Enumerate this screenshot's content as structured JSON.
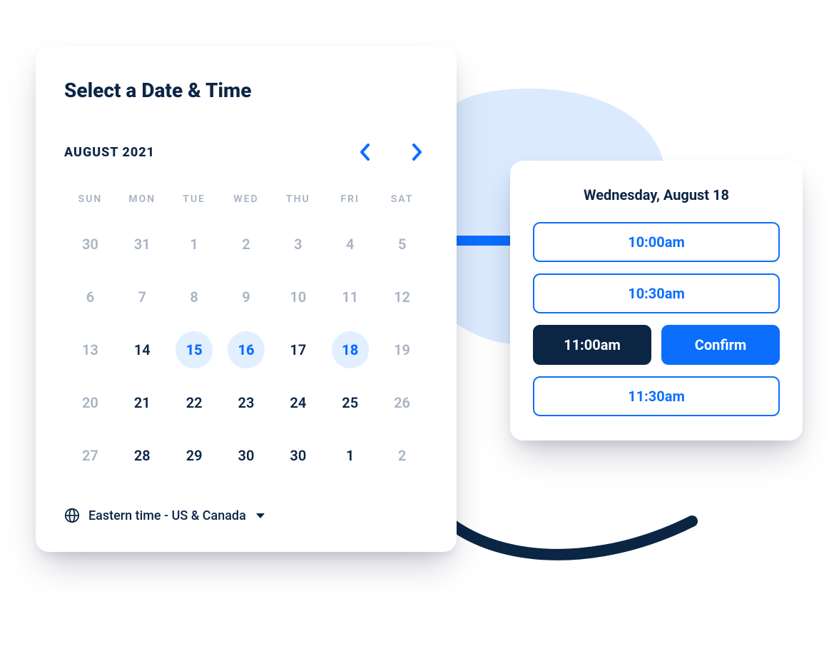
{
  "calendar": {
    "title": "Select a Date & Time",
    "month_label": "AUGUST 2021",
    "dow": [
      "SUN",
      "MON",
      "TUE",
      "WED",
      "THU",
      "FRI",
      "SAT"
    ],
    "weeks": [
      [
        {
          "n": "30",
          "state": "muted"
        },
        {
          "n": "31",
          "state": "muted"
        },
        {
          "n": "1",
          "state": "muted"
        },
        {
          "n": "2",
          "state": "muted"
        },
        {
          "n": "3",
          "state": "muted"
        },
        {
          "n": "4",
          "state": "muted"
        },
        {
          "n": "5",
          "state": "muted"
        }
      ],
      [
        {
          "n": "6",
          "state": "muted"
        },
        {
          "n": "7",
          "state": "muted"
        },
        {
          "n": "8",
          "state": "muted"
        },
        {
          "n": "9",
          "state": "muted"
        },
        {
          "n": "10",
          "state": "muted"
        },
        {
          "n": "11",
          "state": "muted"
        },
        {
          "n": "12",
          "state": "muted"
        }
      ],
      [
        {
          "n": "13",
          "state": "muted"
        },
        {
          "n": "14",
          "state": "in-month"
        },
        {
          "n": "15",
          "state": "available"
        },
        {
          "n": "16",
          "state": "available"
        },
        {
          "n": "17",
          "state": "in-month"
        },
        {
          "n": "18",
          "state": "available"
        },
        {
          "n": "19",
          "state": "muted"
        }
      ],
      [
        {
          "n": "20",
          "state": "muted"
        },
        {
          "n": "21",
          "state": "in-month"
        },
        {
          "n": "22",
          "state": "in-month"
        },
        {
          "n": "23",
          "state": "in-month"
        },
        {
          "n": "24",
          "state": "in-month"
        },
        {
          "n": "25",
          "state": "in-month"
        },
        {
          "n": "26",
          "state": "muted"
        }
      ],
      [
        {
          "n": "27",
          "state": "muted"
        },
        {
          "n": "28",
          "state": "in-month"
        },
        {
          "n": "29",
          "state": "in-month"
        },
        {
          "n": "30",
          "state": "in-month"
        },
        {
          "n": "30",
          "state": "in-month"
        },
        {
          "n": "1",
          "state": "in-month"
        },
        {
          "n": "2",
          "state": "muted"
        }
      ]
    ],
    "timezone": "Eastern time - US & Canada"
  },
  "timepanel": {
    "date_label": "Wednesday, August 18",
    "slots": [
      {
        "label": "10:00am",
        "state": "open"
      },
      {
        "label": "10:30am",
        "state": "open"
      },
      {
        "label": "11:00am",
        "state": "selected"
      },
      {
        "label": "11:30am",
        "state": "open"
      }
    ],
    "confirm_label": "Confirm"
  }
}
